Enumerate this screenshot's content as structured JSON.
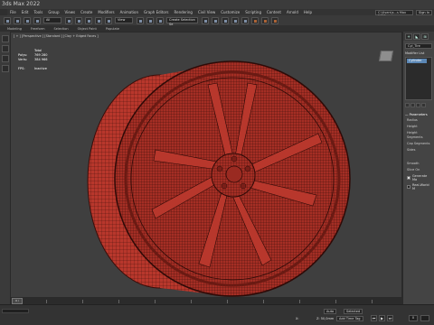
{
  "window": {
    "title": "3ds Max 2022"
  },
  "menu": {
    "items": [
      "File",
      "Edit",
      "Tools",
      "Group",
      "Views",
      "Create",
      "Modifiers",
      "Animation",
      "Graph Editors",
      "Rendering",
      "Civil View",
      "Customize",
      "Scripting",
      "Content",
      "Arnold",
      "Help"
    ],
    "workspace": "C:\\Users\\s...s Max 2022",
    "sign_in": "Sign In"
  },
  "toolbar": {
    "filter_select": "All",
    "view_select": "View",
    "selection_set": "Create Selection Se"
  },
  "ribbon": {
    "tabs": [
      "Modeling",
      "Freeform",
      "Selection",
      "Object Paint",
      "Populate"
    ]
  },
  "viewport": {
    "label": "[ + ] [Perspective ] [Standard ] [Clay + Edged Faces ]",
    "stats": {
      "total_label": "Total",
      "polys_label": "Polys:",
      "polys_value": "769 280",
      "verts_label": "Verts:",
      "verts_value": "384 966",
      "fps_label": "FPS:",
      "fps_value": "Inactive"
    },
    "wheel_color": "#b8372c",
    "wire_color": "#3a0d09"
  },
  "command_panel": {
    "object_name": "Cyl_Tire",
    "modifier_list": "Modifier List",
    "stack_item": "Cylinder",
    "parameters_title": "Parameters",
    "params": [
      "Radius",
      "Height",
      "Height Segments",
      "Cap Segments",
      "Sides"
    ],
    "smooth": "Smooth",
    "slice_on": "Slice On",
    "generate_mapping": "Generate Ma",
    "real_world": "Real-World M"
  },
  "timeline": {
    "frame_label": "0 / 100"
  },
  "status": {
    "x_coord": "X:",
    "z_coord": "Z: 50,0mm",
    "add_time_tag": "Add Time Tag",
    "selected": "Selected",
    "frame": "0"
  }
}
